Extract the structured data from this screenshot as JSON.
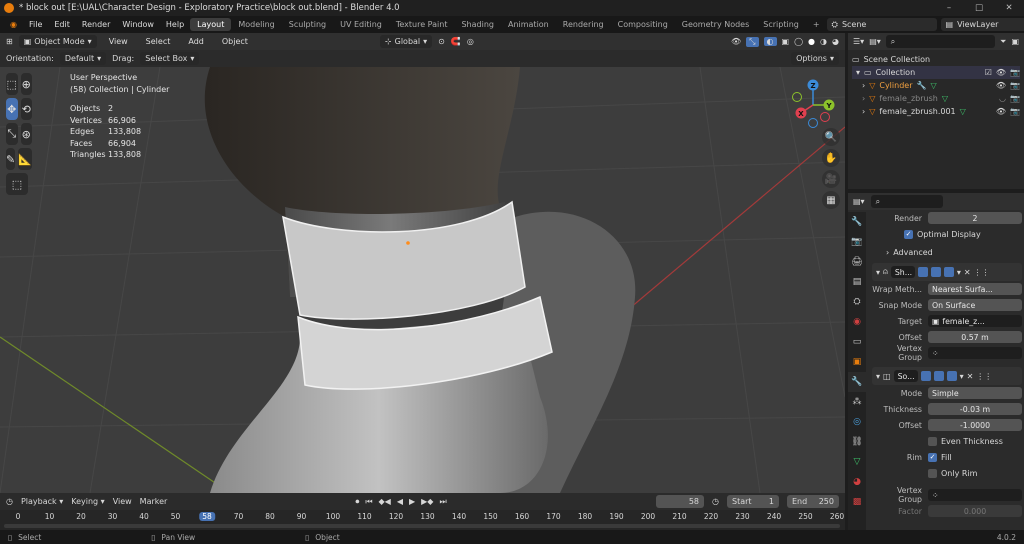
{
  "window": {
    "title": "* block out [E:\\UAL\\Character Design - Exploratory Practice\\block out.blend] - Blender 4.0",
    "controls": [
      "–",
      "□",
      "✕"
    ]
  },
  "menu": {
    "items": [
      "File",
      "Edit",
      "Render",
      "Window",
      "Help"
    ]
  },
  "workspaces": [
    "Layout",
    "Modeling",
    "Sculpting",
    "UV Editing",
    "Texture Paint",
    "Shading",
    "Animation",
    "Rendering",
    "Compositing",
    "Geometry Nodes",
    "Scripting",
    "+"
  ],
  "scene": {
    "name": "Scene",
    "view_layer": "ViewLayer"
  },
  "viewport_header": {
    "mode": "Object Mode",
    "view": "View",
    "select": "Select",
    "add": "Add",
    "object": "Object",
    "transform": "Global"
  },
  "tool_header": {
    "orientation_label": "Orientation:",
    "orientation": "Default",
    "drag_label": "Drag:",
    "drag": "Select Box",
    "options": "Options"
  },
  "overlay": {
    "view_name": "User Perspective",
    "collection": "(58) Collection | Cylinder",
    "stats": [
      {
        "k": "Objects",
        "v": "2"
      },
      {
        "k": "Vertices",
        "v": "66,906"
      },
      {
        "k": "Edges",
        "v": "133,808"
      },
      {
        "k": "Faces",
        "v": "66,904"
      },
      {
        "k": "Triangles",
        "v": "133,808"
      }
    ]
  },
  "gizmo": {
    "z": "Z",
    "y": "Y",
    "x": "X"
  },
  "timeline": {
    "playback": "Playback",
    "keying": "Keying",
    "view": "View",
    "marker": "Marker",
    "current": "58",
    "start_label": "Start",
    "start": "1",
    "end_label": "End",
    "end": "250",
    "ticks": [
      "0",
      "10",
      "20",
      "30",
      "40",
      "50",
      "58",
      "70",
      "80",
      "90",
      "100",
      "110",
      "120",
      "130",
      "140",
      "150",
      "160",
      "170",
      "180",
      "190",
      "200",
      "210",
      "220",
      "230",
      "240",
      "250",
      "260"
    ]
  },
  "status": {
    "select": "Select",
    "pan": "Pan View",
    "object": "Object",
    "version": "4.0.2"
  },
  "outliner": {
    "root": "Scene Collection",
    "collection": "Collection",
    "objects": [
      "Cylinder",
      "female_zbrush",
      "female_zbrush.001"
    ]
  },
  "properties": {
    "render_label": "Render",
    "render_value": "2",
    "optimal_display": "Optimal Display",
    "advanced": "Advanced",
    "shrinkwrap": {
      "name": "Sh...",
      "wrap_method_label": "Wrap Meth...",
      "wrap_method": "Nearest Surfa...",
      "snap_mode_label": "Snap Mode",
      "snap_mode": "On Surface",
      "target_label": "Target",
      "target": "female_z...",
      "offset_label": "Offset",
      "offset": "0.57 m",
      "vgroup_label": "Vertex Group"
    },
    "solidify": {
      "name": "So...",
      "mode_label": "Mode",
      "mode": "Simple",
      "thickness_label": "Thickness",
      "thickness": "-0.03 m",
      "offset_label": "Offset",
      "offset": "-1.0000",
      "even_thickness": "Even Thickness",
      "rim_label": "Rim",
      "fill": "Fill",
      "only_rim": "Only Rim",
      "vgroup_label": "Vertex Group",
      "factor_label": "Factor",
      "factor": "0.000"
    }
  },
  "colors": {
    "accent": "#4772b3",
    "orange": "#e87d0d",
    "x_axis": "#e0404f",
    "y_axis": "#8cc22b",
    "z_axis": "#3b8bd8"
  }
}
